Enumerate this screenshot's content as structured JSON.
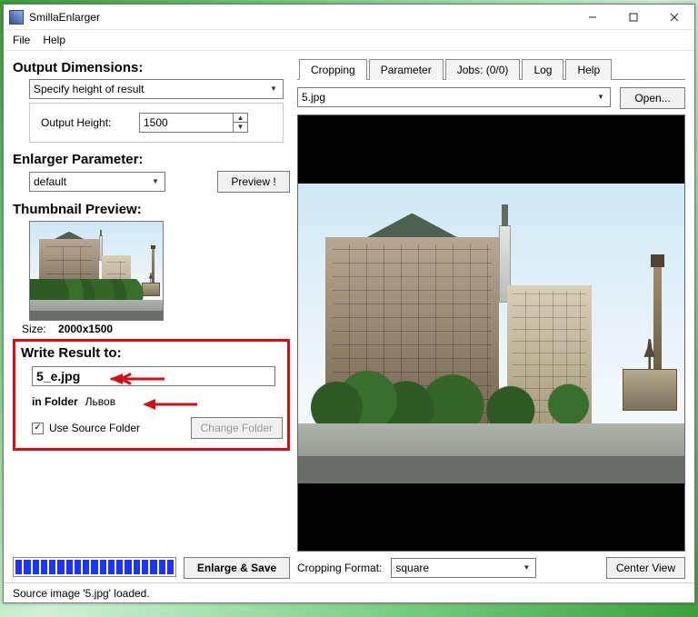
{
  "window": {
    "title": "SmillaEnlarger"
  },
  "menu": {
    "file": "File",
    "help": "Help"
  },
  "left": {
    "output_dimensions_heading": "Output Dimensions:",
    "method": "Specify height of result",
    "output_height_label": "Output Height:",
    "output_height_value": "1500",
    "enlarger_parameter_heading": "Enlarger Parameter:",
    "parameter_preset": "default",
    "preview_button": "Preview !",
    "thumbnail_heading": "Thumbnail Preview:",
    "size_label": "Size:",
    "size_value": "2000x1500",
    "write_result_heading": "Write Result to:",
    "result_filename": "5_e.jpg",
    "in_folder_label": "in Folder",
    "folder_name": "Львов",
    "use_source_folder_label": "Use Source Folder",
    "use_source_folder_checked": "✓",
    "change_folder_button": "Change Folder",
    "enlarge_save_button": "Enlarge & Save"
  },
  "right": {
    "tabs": {
      "cropping": "Cropping",
      "parameter": "Parameter",
      "jobs": "Jobs: (0/0)",
      "log": "Log",
      "help": "Help"
    },
    "current_file": "5.jpg",
    "open_button": "Open...",
    "cropping_format_label": "Cropping Format:",
    "cropping_format_value": "square",
    "center_view_button": "Center View"
  },
  "status": {
    "text": "Source image '5.jpg' loaded."
  }
}
